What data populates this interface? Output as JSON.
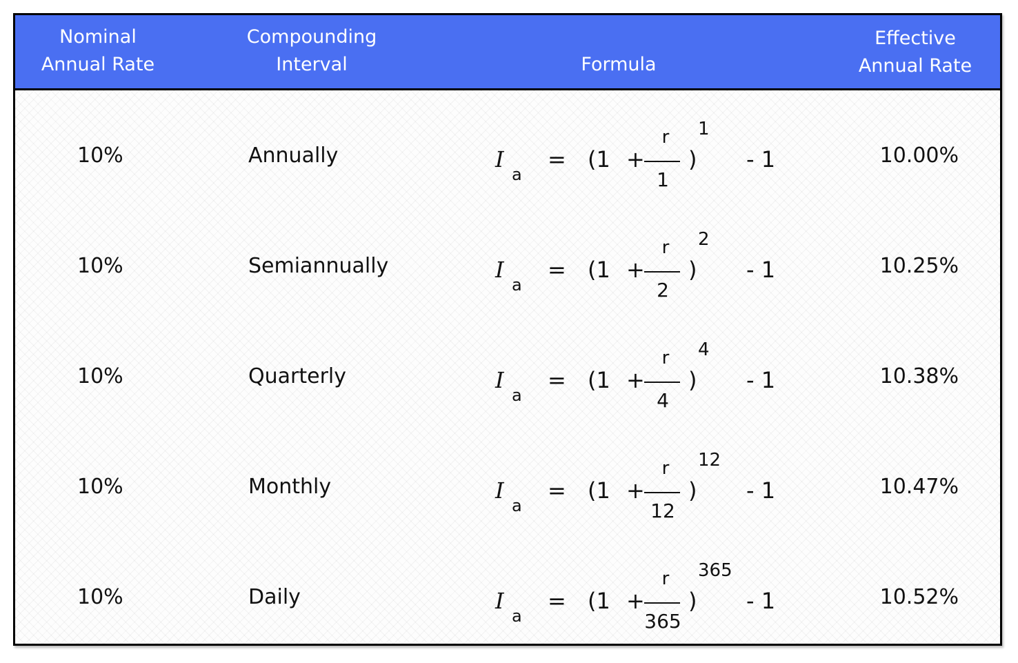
{
  "header": {
    "nominal": [
      "Nominal",
      "Annual Rate"
    ],
    "interval": [
      "Compounding",
      "Interval"
    ],
    "formula": "Formula",
    "effective": [
      "Effective",
      "Annual Rate"
    ]
  },
  "formula_parts": {
    "lhs": "I",
    "lhs_sub": "a",
    "equals": "=",
    "open": "(1",
    "plus": "+",
    "numerator": "r",
    "close": ")",
    "minus": "- 1"
  },
  "rows": [
    {
      "nominal": "10%",
      "interval": "Annually",
      "n": "1",
      "effective": "10.00%"
    },
    {
      "nominal": "10%",
      "interval": "Semiannually",
      "n": "2",
      "effective": "10.25%"
    },
    {
      "nominal": "10%",
      "interval": "Quarterly",
      "n": "4",
      "effective": "10.38%"
    },
    {
      "nominal": "10%",
      "interval": "Monthly",
      "n": "12",
      "effective": "10.47%"
    },
    {
      "nominal": "10%",
      "interval": "Daily",
      "n": "365",
      "effective": "10.52%"
    }
  ]
}
